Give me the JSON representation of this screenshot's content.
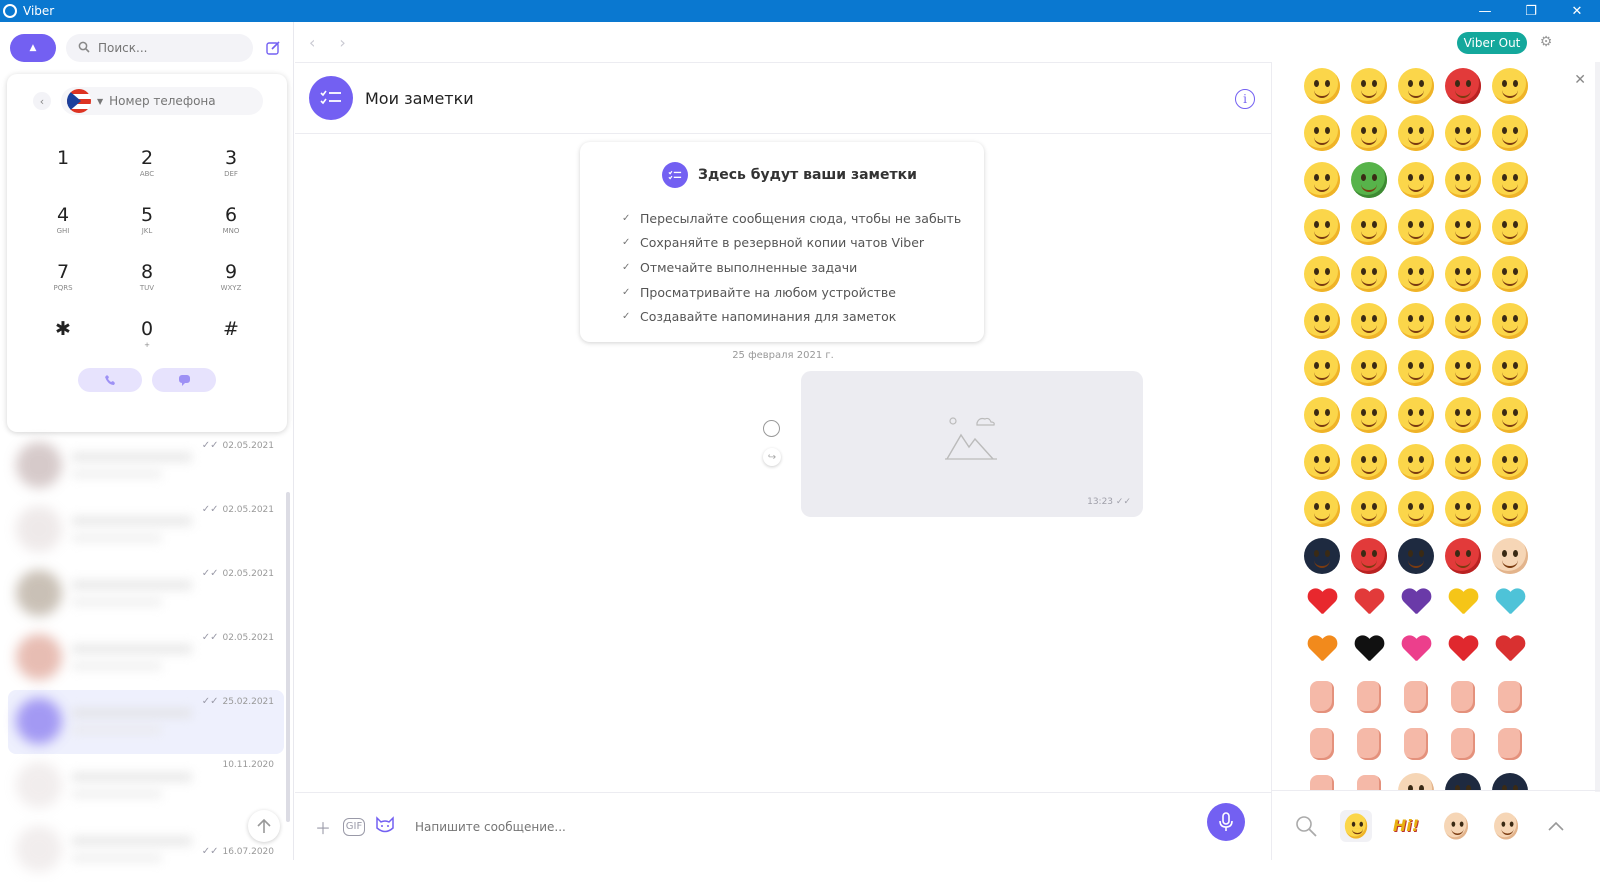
{
  "window": {
    "title": "Viber"
  },
  "left": {
    "search_placeholder": "Поиск...",
    "dialer": {
      "phone_placeholder": "Номер телефона",
      "keys": [
        {
          "digit": "1",
          "letters": ""
        },
        {
          "digit": "2",
          "letters": "ABC"
        },
        {
          "digit": "3",
          "letters": "DEF"
        },
        {
          "digit": "4",
          "letters": "GHI"
        },
        {
          "digit": "5",
          "letters": "JKL"
        },
        {
          "digit": "6",
          "letters": "MNO"
        },
        {
          "digit": "7",
          "letters": "PQRS"
        },
        {
          "digit": "8",
          "letters": "TUV"
        },
        {
          "digit": "9",
          "letters": "WXYZ"
        },
        {
          "digit": "✱",
          "letters": ""
        },
        {
          "digit": "0",
          "letters": "+"
        },
        {
          "digit": "#",
          "letters": ""
        }
      ]
    },
    "chats": [
      {
        "time": "02.05.2021"
      },
      {
        "time": "02.05.2021"
      },
      {
        "time": "02.05.2021"
      },
      {
        "time": "02.05.2021"
      },
      {
        "time": "25.02.2021"
      },
      {
        "time": "10.11.2020"
      },
      {
        "time": "16.07.2020"
      }
    ]
  },
  "header": {
    "viber_out": "Viber Out",
    "chat_title": "Мои заметки"
  },
  "notes_card": {
    "title": "Здесь будут ваши заметки",
    "tips": [
      "Пересылайте сообщения сюда, чтобы не забыть",
      "Сохраняйте в резервной копии чатов Viber",
      "Отмечайте выполненные задачи",
      "Просматривайте на любом устройстве",
      "Создавайте напоминания для заметок"
    ]
  },
  "date_separator": "25 февраля 2021 г.",
  "message": {
    "time": "13:23"
  },
  "composer": {
    "placeholder": "Напишите сообщение..."
  },
  "emoji_panel": {
    "hi_sticker": "Hi!"
  },
  "colors": {
    "accent": "#7360f2",
    "viber_out": "#14a89c",
    "titlebar": "#0a78d0"
  }
}
